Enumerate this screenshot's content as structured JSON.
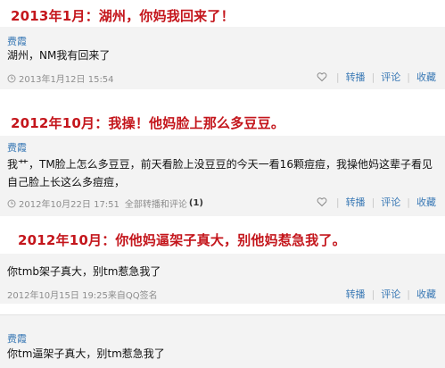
{
  "post1": {
    "caption": "2013年1月：湖州，你妈我回来了！",
    "author": "费霞",
    "text": "湖州，NM我有回来了",
    "time": "2013年1月12日 15:54",
    "repost": "转播",
    "comment": "评论",
    "collect": "收藏"
  },
  "post2": {
    "caption": "2012年10月：我操！他妈脸上那么多豆豆。",
    "author": "费霞",
    "text": "我艹，TM脸上怎么多豆豆，前天看脸上没豆豆的今天一看16颗痘痘，我操他妈这辈子看见自己脸上长这么多痘痘，",
    "time": "2012年10月22日 17:51",
    "all_label": "全部转播和评论",
    "all_count": "(1)",
    "repost": "转播",
    "comment": "评论",
    "collect": "收藏"
  },
  "post3": {
    "caption": "2012年10月：你他妈逼架子真大，别他妈惹急我了。",
    "author": "",
    "text": "你tmb架子真大，别tm惹急我了",
    "time": "2012年10月15日 19:25来自QQ签名",
    "repost": "转播",
    "comment": "评论",
    "collect": "收藏"
  },
  "post4": {
    "author": "费霞",
    "text": "你tm逼架子真大，别tm惹急我了"
  }
}
